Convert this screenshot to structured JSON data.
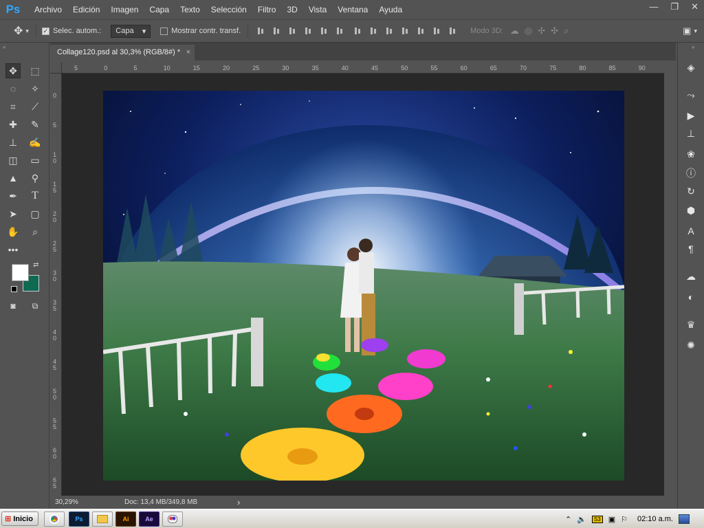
{
  "app": {
    "logo": "Ps"
  },
  "menu": [
    "Archivo",
    "Edición",
    "Imagen",
    "Capa",
    "Texto",
    "Selección",
    "Filtro",
    "3D",
    "Vista",
    "Ventana",
    "Ayuda"
  ],
  "window": {
    "minimize": "—",
    "restore": "❐",
    "close": "✕"
  },
  "options": {
    "auto_select_label": "Selec. autom.:",
    "auto_select_value": "Capa",
    "show_transform_label": "Mostrar contr. transf.",
    "mode3d_label": "Modo 3D:"
  },
  "document": {
    "tab_title": "Collage120.psd al 30,3% (RGB/8#) *",
    "close": "×",
    "zoom": "30,29%",
    "doc_size": "Doc: 13,4 MB/349,8 MB",
    "status_arrow": "›"
  },
  "ruler": {
    "h": [
      "5",
      "0",
      "5",
      "10",
      "15",
      "20",
      "25",
      "30",
      "35",
      "40",
      "45",
      "50",
      "55",
      "60",
      "65",
      "70",
      "75",
      "80",
      "85",
      "90"
    ],
    "v": [
      "0",
      "5",
      "1 0",
      "1 5",
      "2 0",
      "2 5",
      "3 0",
      "3 5",
      "4 0",
      "4 5",
      "5 0",
      "5 5",
      "6 0",
      "6 5"
    ]
  },
  "colors": {
    "foreground": "#ffffff",
    "background": "#0e6b52",
    "accent": "#31a8ff"
  },
  "taskbar": {
    "start_label": "Inicio",
    "apps": [
      "chrome-icon",
      "Ps",
      "explorer-icon",
      "Ai",
      "Ae",
      "paint-icon"
    ],
    "clock": "02:10 a.m."
  }
}
